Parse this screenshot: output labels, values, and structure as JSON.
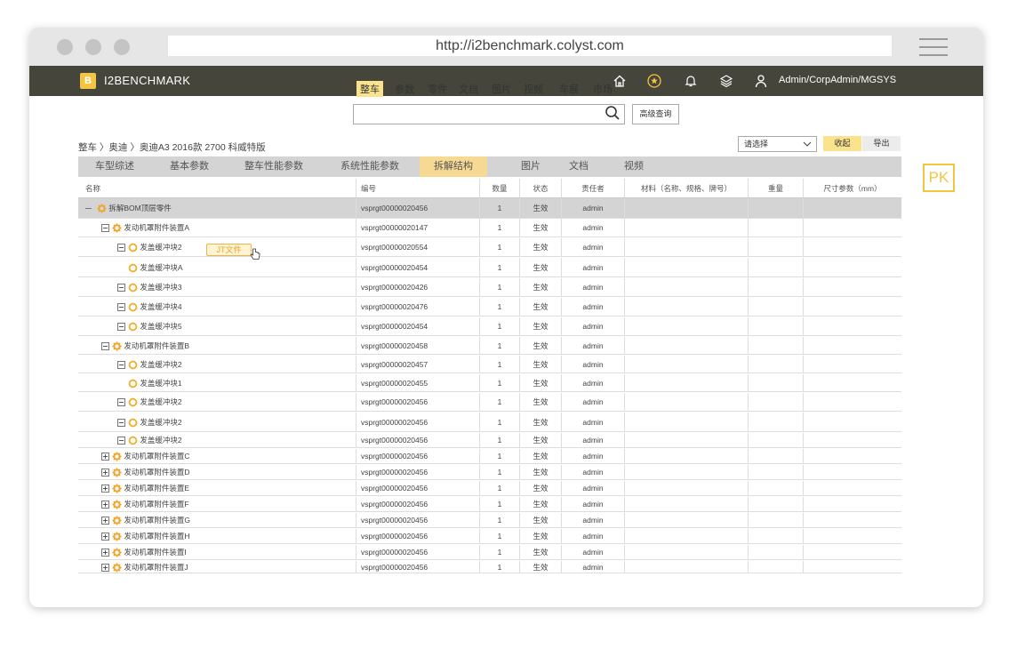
{
  "browser": {
    "url": "http://i2benchmark.colyst.com"
  },
  "app": {
    "logo_letter": "B",
    "brand": "I2BENCHMARK",
    "user": "Admin/CorpAdmin/MGSYS",
    "nav_icons": [
      "home-icon",
      "star-icon",
      "bell-icon",
      "layers-icon",
      "user-icon"
    ]
  },
  "search": {
    "tabs": [
      "整车",
      "参数",
      "零件",
      "文档",
      "图片",
      "视频",
      "车展",
      "市场"
    ],
    "active_tab": "整车",
    "advanced_label": "高级查询"
  },
  "breadcrumb": "整车 〉奥迪 〉奥迪A3  2016款  2700  科威特版",
  "toolbar": {
    "select_placeholder": "请选择",
    "collapse_label": "收起",
    "export_label": "导出"
  },
  "pk_label": "PK",
  "tabs": [
    "车型综述",
    "基本参数",
    "整车性能参数",
    "系统性能参数",
    "拆解结构",
    "图片",
    "文档",
    "视频"
  ],
  "active_tab": "拆解结构",
  "table": {
    "columns": [
      "名称",
      "编号",
      "数量",
      "状态",
      "责任者",
      "材料（名称、规格、牌号）",
      "重量",
      "尺寸参数（mm）"
    ],
    "rows": [
      {
        "name": "拆解BOM顶层零件",
        "code": "vsprgt00000020456",
        "qty": "1",
        "status": "生效",
        "owner": "admin",
        "level": 0,
        "type": "gear",
        "sign": "minus-line"
      },
      {
        "name": "发动机罩附件装置A",
        "code": "vsprgt00000020147",
        "qty": "1",
        "status": "生效",
        "owner": "admin",
        "level": 1,
        "type": "gear",
        "sign": "minus"
      },
      {
        "name": "发盖缓冲块2",
        "code": "vsprgt00000020554",
        "qty": "1",
        "status": "生效",
        "owner": "admin",
        "level": 2,
        "type": "ring",
        "sign": "minus"
      },
      {
        "name": "发盖缓冲块A",
        "code": "vsprgt00000020454",
        "qty": "1",
        "status": "生效",
        "owner": "admin",
        "level": 3,
        "type": "ring",
        "sign": "none"
      },
      {
        "name": "发盖缓冲块3",
        "code": "vsprgt00000020426",
        "qty": "1",
        "status": "生效",
        "owner": "admin",
        "level": 2,
        "type": "ring",
        "sign": "minus"
      },
      {
        "name": "发盖缓冲块4",
        "code": "vsprgt00000020476",
        "qty": "1",
        "status": "生效",
        "owner": "admin",
        "level": 2,
        "type": "ring",
        "sign": "minus"
      },
      {
        "name": "发盖缓冲块5",
        "code": "vsprgt00000020454",
        "qty": "1",
        "status": "生效",
        "owner": "admin",
        "level": 2,
        "type": "ring",
        "sign": "minus"
      },
      {
        "name": "发动机罩附件装置B",
        "code": "vsprgt00000020458",
        "qty": "1",
        "status": "生效",
        "owner": "admin",
        "level": 1,
        "type": "gear",
        "sign": "minus"
      },
      {
        "name": "发盖缓冲块2",
        "code": "vsprgt00000020457",
        "qty": "1",
        "status": "生效",
        "owner": "admin",
        "level": 2,
        "type": "ring",
        "sign": "minus"
      },
      {
        "name": "发盖缓冲块1",
        "code": "vsprgt00000020455",
        "qty": "1",
        "status": "生效",
        "owner": "admin",
        "level": 3,
        "type": "ring",
        "sign": "none"
      },
      {
        "name": "发盖缓冲块2",
        "code": "vsprgt00000020456",
        "qty": "1",
        "status": "生效",
        "owner": "admin",
        "level": 2,
        "type": "ring",
        "sign": "minus"
      },
      {
        "name": "发盖缓冲块2",
        "code": "vsprgt00000020456",
        "qty": "1",
        "status": "生效",
        "owner": "admin",
        "level": 2,
        "type": "ring",
        "sign": "minus"
      },
      {
        "name": "发盖缓冲块2",
        "code": "vsprgt00000020456",
        "qty": "1",
        "status": "生效",
        "owner": "admin",
        "level": 2,
        "type": "ring",
        "sign": "minus"
      },
      {
        "name": "发动机罩附件装置C",
        "code": "vsprgt00000020456",
        "qty": "1",
        "status": "生效",
        "owner": "admin",
        "level": 1,
        "type": "gear",
        "sign": "plus"
      },
      {
        "name": "发动机罩附件装置D",
        "code": "vsprgt00000020456",
        "qty": "1",
        "status": "生效",
        "owner": "admin",
        "level": 1,
        "type": "gear",
        "sign": "plus"
      },
      {
        "name": "发动机罩附件装置E",
        "code": "vsprgt00000020456",
        "qty": "1",
        "status": "生效",
        "owner": "admin",
        "level": 1,
        "type": "gear",
        "sign": "plus"
      },
      {
        "name": "发动机罩附件装置F",
        "code": "vsprgt00000020456",
        "qty": "1",
        "status": "生效",
        "owner": "admin",
        "level": 1,
        "type": "gear",
        "sign": "plus"
      },
      {
        "name": "发动机罩附件装置G",
        "code": "vsprgt00000020456",
        "qty": "1",
        "status": "生效",
        "owner": "admin",
        "level": 1,
        "type": "gear",
        "sign": "plus"
      },
      {
        "name": "发动机罩附件装置H",
        "code": "vsprgt00000020456",
        "qty": "1",
        "status": "生效",
        "owner": "admin",
        "level": 1,
        "type": "gear",
        "sign": "plus"
      },
      {
        "name": "发动机罩附件装置I",
        "code": "vsprgt00000020456",
        "qty": "1",
        "status": "生效",
        "owner": "admin",
        "level": 1,
        "type": "gear",
        "sign": "plus"
      },
      {
        "name": "发动机罩附件装置J",
        "code": "vsprgt00000020456",
        "qty": "1",
        "status": "生效",
        "owner": "admin",
        "level": 1,
        "type": "gear",
        "sign": "plus"
      }
    ]
  },
  "jt_badge": "JT文件",
  "colors": {
    "accent": "#f4c542",
    "tab_active": "#f6d992",
    "appbar": "#45453b",
    "icon_orange": "#f0a72e"
  }
}
